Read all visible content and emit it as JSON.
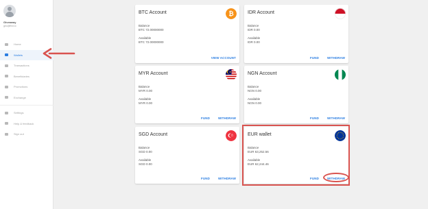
{
  "sidebar": {
    "user_name": "Giveaway",
    "user_email": "geo@flint.io",
    "items": [
      {
        "label": "Home",
        "icon": "home-icon",
        "active": false
      },
      {
        "label": "Wallets",
        "icon": "wallet-icon",
        "active": true
      },
      {
        "label": "Transactions",
        "icon": "transactions-icon",
        "active": false
      },
      {
        "label": "Beneficiaries",
        "icon": "beneficiaries-icon",
        "active": false
      },
      {
        "label": "Promotions",
        "icon": "promotions-icon",
        "active": false
      },
      {
        "label": "Exchange",
        "icon": "exchange-icon",
        "active": false
      },
      {
        "label": "Settings",
        "icon": "gear-icon",
        "active": false
      },
      {
        "label": "Help & feedback",
        "icon": "help-icon",
        "active": false
      },
      {
        "label": "Sign out",
        "icon": "sign-out-icon",
        "active": false
      }
    ]
  },
  "cards": {
    "btc": {
      "title": "BTC Account",
      "balance_label": "Balance",
      "balance_value": "BTC 72.00000000",
      "available_label": "Available",
      "available_value": "BTC 72.00000000",
      "view_label": "VIEW ACCOUNT",
      "flag_icon": "bitcoin-icon"
    },
    "idr": {
      "title": "IDR Account",
      "balance_label": "Balance",
      "balance_value": "IDR 0.00",
      "available_label": "Available",
      "available_value": "IDR 0.00",
      "fund_label": "FUND",
      "withdraw_label": "WITHDRAW",
      "flag_icon": "indonesia-flag-icon"
    },
    "myr": {
      "title": "MYR Account",
      "balance_label": "Balance",
      "balance_value": "MYR 0.00",
      "available_label": "Available",
      "available_value": "MYR 0.00",
      "fund_label": "FUND",
      "withdraw_label": "WITHDRAW",
      "flag_icon": "malaysia-flag-icon"
    },
    "ngn": {
      "title": "NGN Account",
      "balance_label": "Balance",
      "balance_value": "NGN 0.00",
      "available_label": "Available",
      "available_value": "NGN 0.00",
      "fund_label": "FUND",
      "withdraw_label": "WITHDRAW",
      "flag_icon": "nigeria-flag-icon"
    },
    "sgd": {
      "title": "SGD Account",
      "balance_label": "Balance",
      "balance_value": "SGD 0.00",
      "available_label": "Available",
      "available_value": "SGD 0.00",
      "fund_label": "FUND",
      "withdraw_label": "WITHDRAW",
      "flag_icon": "singapore-flag-icon"
    },
    "eur": {
      "title": "EUR wallet",
      "balance_label": "Balance",
      "balance_value": "EUR 63,252.56",
      "available_label": "Available",
      "available_value": "EUR 62,244.46",
      "fund_label": "FUND",
      "withdraw_label": "WITHDRAW",
      "flag_icon": "eu-flag-icon"
    }
  },
  "colors": {
    "accent": "#2a7de1",
    "annotation": "#d9534f",
    "bitcoin": "#f7931a"
  }
}
